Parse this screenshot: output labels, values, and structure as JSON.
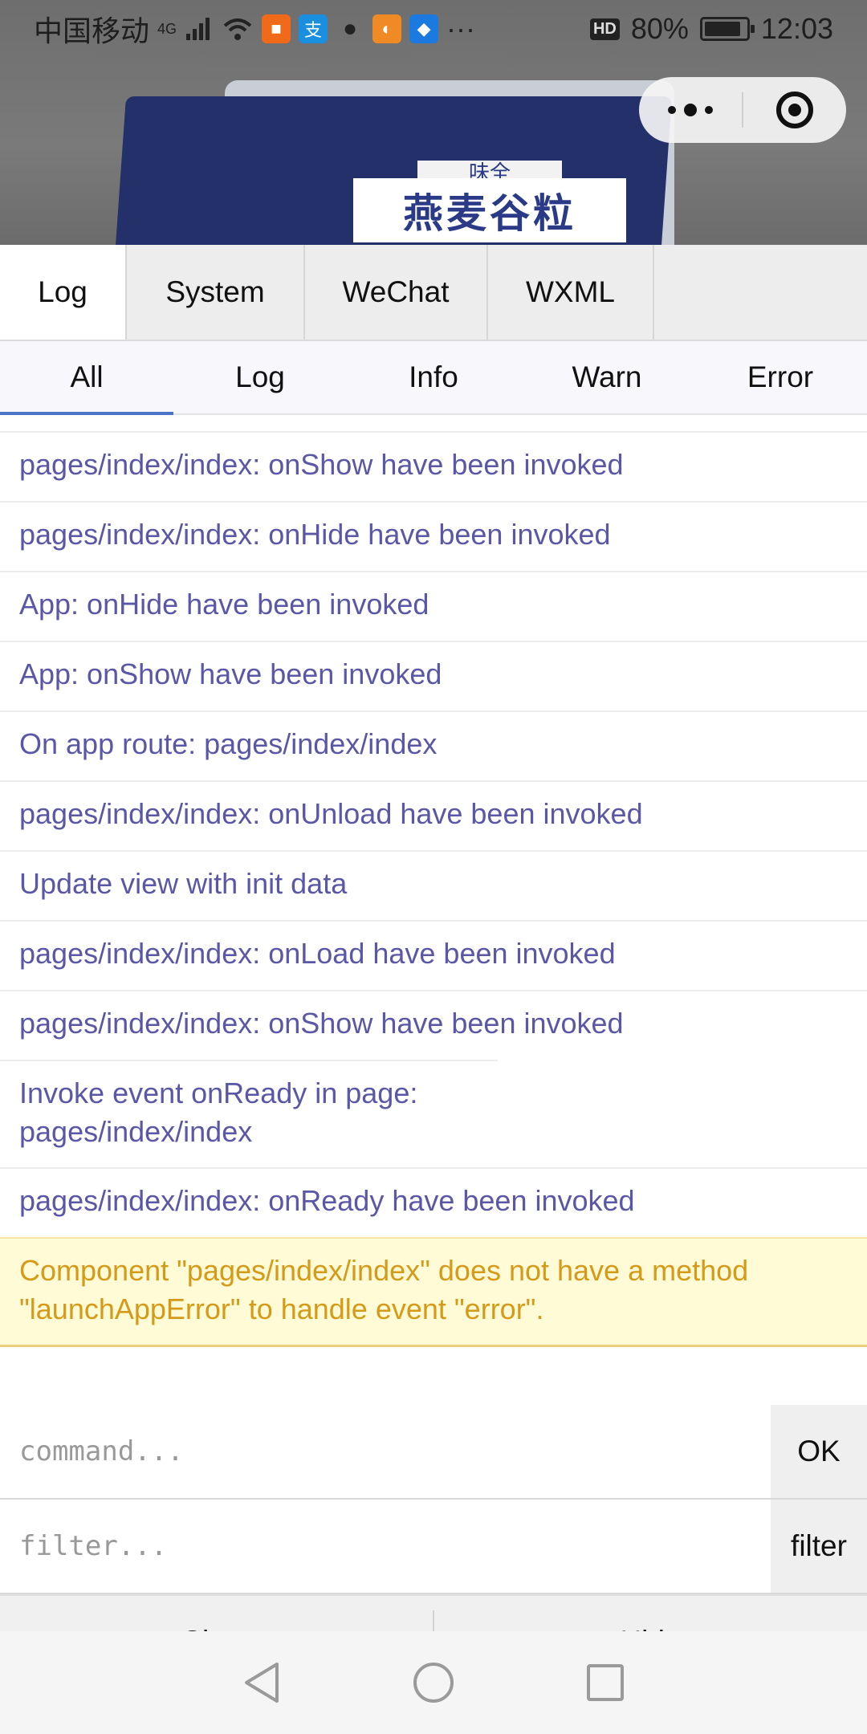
{
  "status_bar": {
    "carrier": "中国移动",
    "network": "4G",
    "battery": "80%",
    "time": "12:03",
    "hd": "HD",
    "more": "···"
  },
  "background_app": {
    "label_main": "燕麦谷粒",
    "label_small": "味全"
  },
  "main_tabs": [
    "Log",
    "System",
    "WeChat",
    "WXML"
  ],
  "sub_tabs": [
    "All",
    "Log",
    "Info",
    "Warn",
    "Error"
  ],
  "logs": [
    {
      "text": "pages/index/index: onShow have been invoked",
      "level": "log"
    },
    {
      "text": "pages/index/index: onHide have been invoked",
      "level": "log"
    },
    {
      "text": "App: onHide have been invoked",
      "level": "log"
    },
    {
      "text": "App: onShow have been invoked",
      "level": "log"
    },
    {
      "text": "On app route: pages/index/index",
      "level": "log"
    },
    {
      "text": "pages/index/index: onUnload have been invoked",
      "level": "log"
    },
    {
      "text": "Update view with init data",
      "level": "log"
    },
    {
      "text": "pages/index/index: onLoad have been invoked",
      "level": "log"
    },
    {
      "text": "pages/index/index: onShow have been invoked",
      "level": "log"
    },
    {
      "text": "Invoke event onReady in page: pages/index/index",
      "level": "log"
    },
    {
      "text": "pages/index/index: onReady have been invoked",
      "level": "log"
    },
    {
      "text": "Component \"pages/index/index\" does not have a method \"launchAppError\" to handle event \"error\".",
      "level": "warn"
    }
  ],
  "command": {
    "placeholder": "command...",
    "button": "OK"
  },
  "filter": {
    "placeholder": "filter...",
    "button": "filter"
  },
  "footer": {
    "clear": "Clear",
    "hide": "Hide"
  },
  "colors": {
    "log_text": "#5a58a6",
    "warn_text": "#d59a18",
    "warn_bg": "#fffbd6",
    "active_tab_underline": "#4a74c8"
  }
}
